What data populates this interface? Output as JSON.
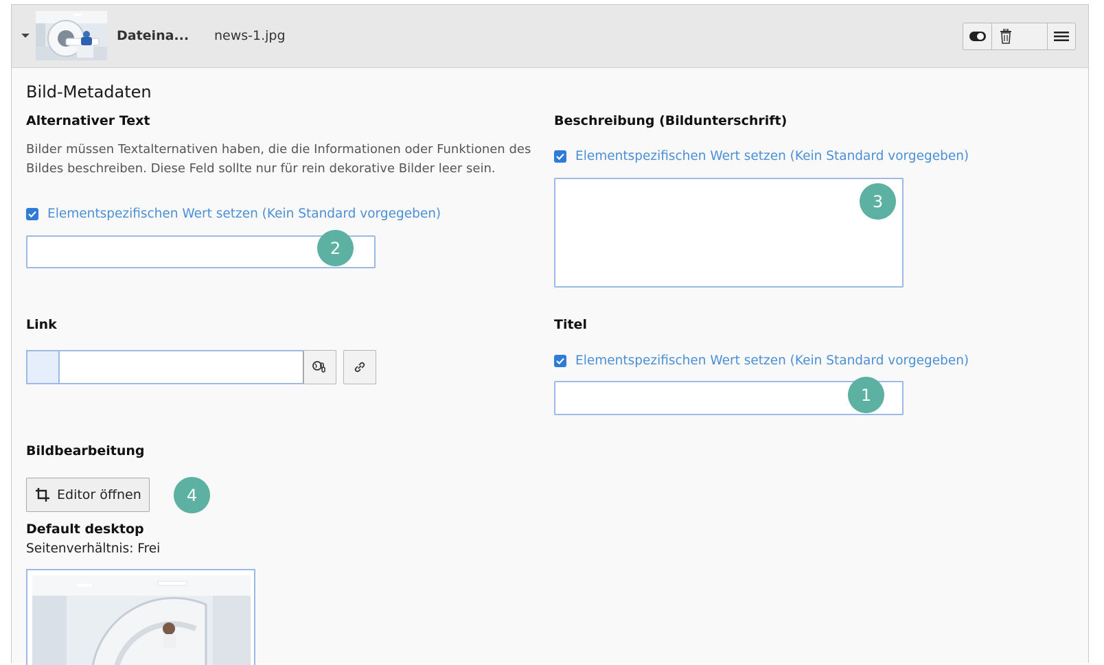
{
  "header": {
    "title": "Dateina...",
    "filename": "news-1.jpg",
    "thumbnail_alt": "MRT-Gerät"
  },
  "section_title": "Bild-Metadaten",
  "alt_text": {
    "label": "Alternativer Text",
    "description": "Bilder müssen Textalternativen haben, die die Informationen oder Funktionen des Bildes beschreiben. Diese Feld sollte nur für rein dekorative Bilder leer sein.",
    "override_label": "Elementspezifischen Wert setzen (Kein Standard vorgegeben)",
    "override_checked": true,
    "value": "",
    "badge": "2"
  },
  "description_field": {
    "label": "Beschreibung (Bildunterschrift)",
    "override_label": "Elementspezifischen Wert setzen (Kein Standard vorgegeben)",
    "override_checked": true,
    "value": "",
    "badge": "3"
  },
  "link": {
    "label": "Link",
    "value": ""
  },
  "title_field": {
    "label": "Titel",
    "override_label": "Elementspezifischen Wert setzen (Kein Standard vorgegeben)",
    "override_checked": true,
    "value": "",
    "badge": "1"
  },
  "image_editing": {
    "label": "Bildbearbeitung",
    "editor_button": "Editor öffnen",
    "badge": "4",
    "crop_variant_title": "Default desktop",
    "aspect_ratio": "Seitenverhältnis: Frei"
  },
  "colors": {
    "accent": "#2f7bd7",
    "link_text": "#4a8fd6",
    "badge": "#5cb1a2",
    "input_border": "#9bbbe6"
  },
  "icons": {
    "toggle": "toggle-visibility-icon",
    "delete": "trash-icon",
    "menu": "hamburger-menu-icon",
    "link_browser": "link-browser-icon",
    "link": "chain-link-icon",
    "crop": "crop-icon"
  }
}
